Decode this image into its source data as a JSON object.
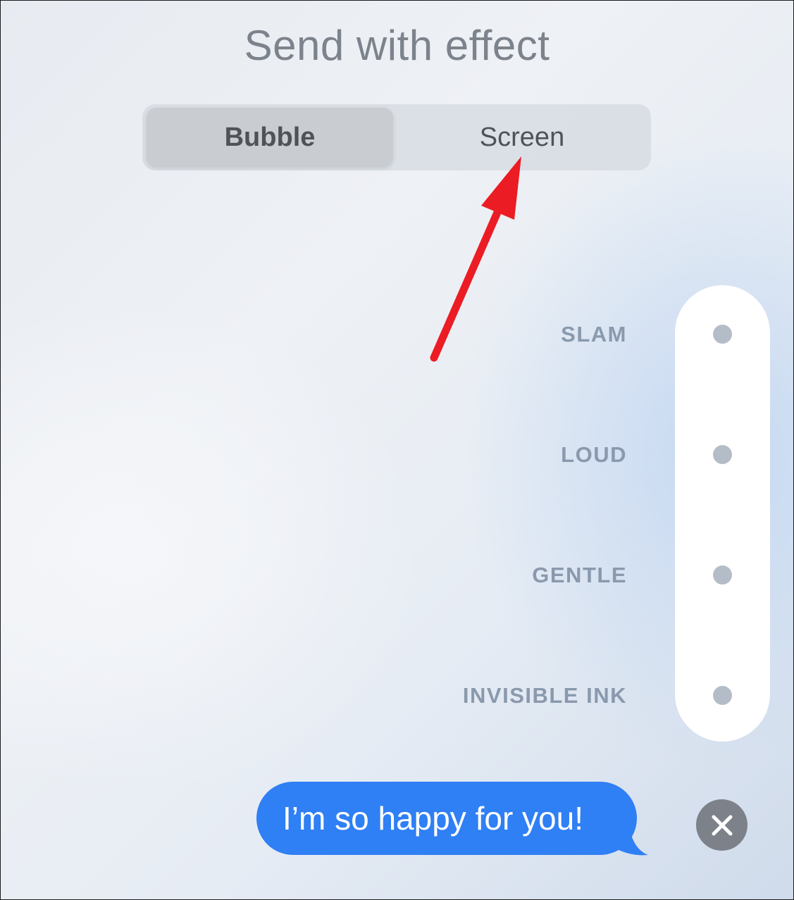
{
  "header": {
    "title": "Send with effect"
  },
  "tabs": [
    {
      "label": "Bubble",
      "selected": true
    },
    {
      "label": "Screen",
      "selected": false
    }
  ],
  "effects": [
    {
      "label": "SLAM"
    },
    {
      "label": "LOUD"
    },
    {
      "label": "GENTLE"
    },
    {
      "label": "INVISIBLE INK"
    }
  ],
  "message": {
    "text": "I’m so happy for you!"
  },
  "colors": {
    "message_bubble": "#2f7ff5",
    "annotation_arrow": "#ec1c24",
    "effect_label": "#8a99ad",
    "close_button": "#7d8189"
  },
  "icons": {
    "close": "close-icon",
    "annotation": "red-arrow"
  }
}
